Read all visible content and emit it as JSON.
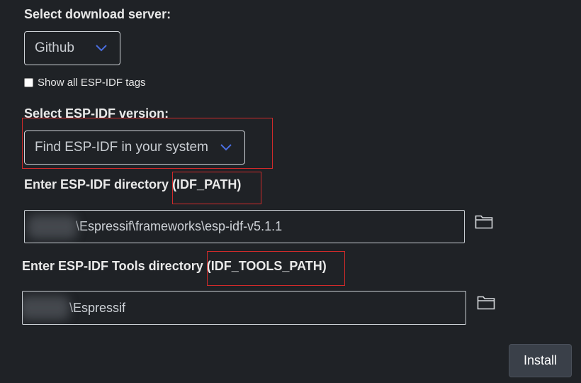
{
  "server": {
    "label": "Select download server:",
    "selected": "Github"
  },
  "show_all_tags": {
    "label": "Show all ESP-IDF tags",
    "checked": false
  },
  "version": {
    "label": "Select ESP-IDF version:",
    "selected": "Find ESP-IDF in your system"
  },
  "idf_path": {
    "label_main": "Enter ESP-IDF directory",
    "label_var": "(IDF_PATH)",
    "value": "\\Espressif\\frameworks\\esp-idf-v5.1.1"
  },
  "idf_tools_path": {
    "label_main": "Enter ESP-IDF Tools directory",
    "label_var": "(IDF_TOOLS_PATH)",
    "value": "\\Espressif"
  },
  "install_button": "Install",
  "colors": {
    "background": "#1f2226",
    "chevron": "#4a6ee0",
    "highlight": "#d02a2a"
  },
  "icons": {
    "dropdown": "chevron-down-icon",
    "browse": "folder-icon"
  }
}
